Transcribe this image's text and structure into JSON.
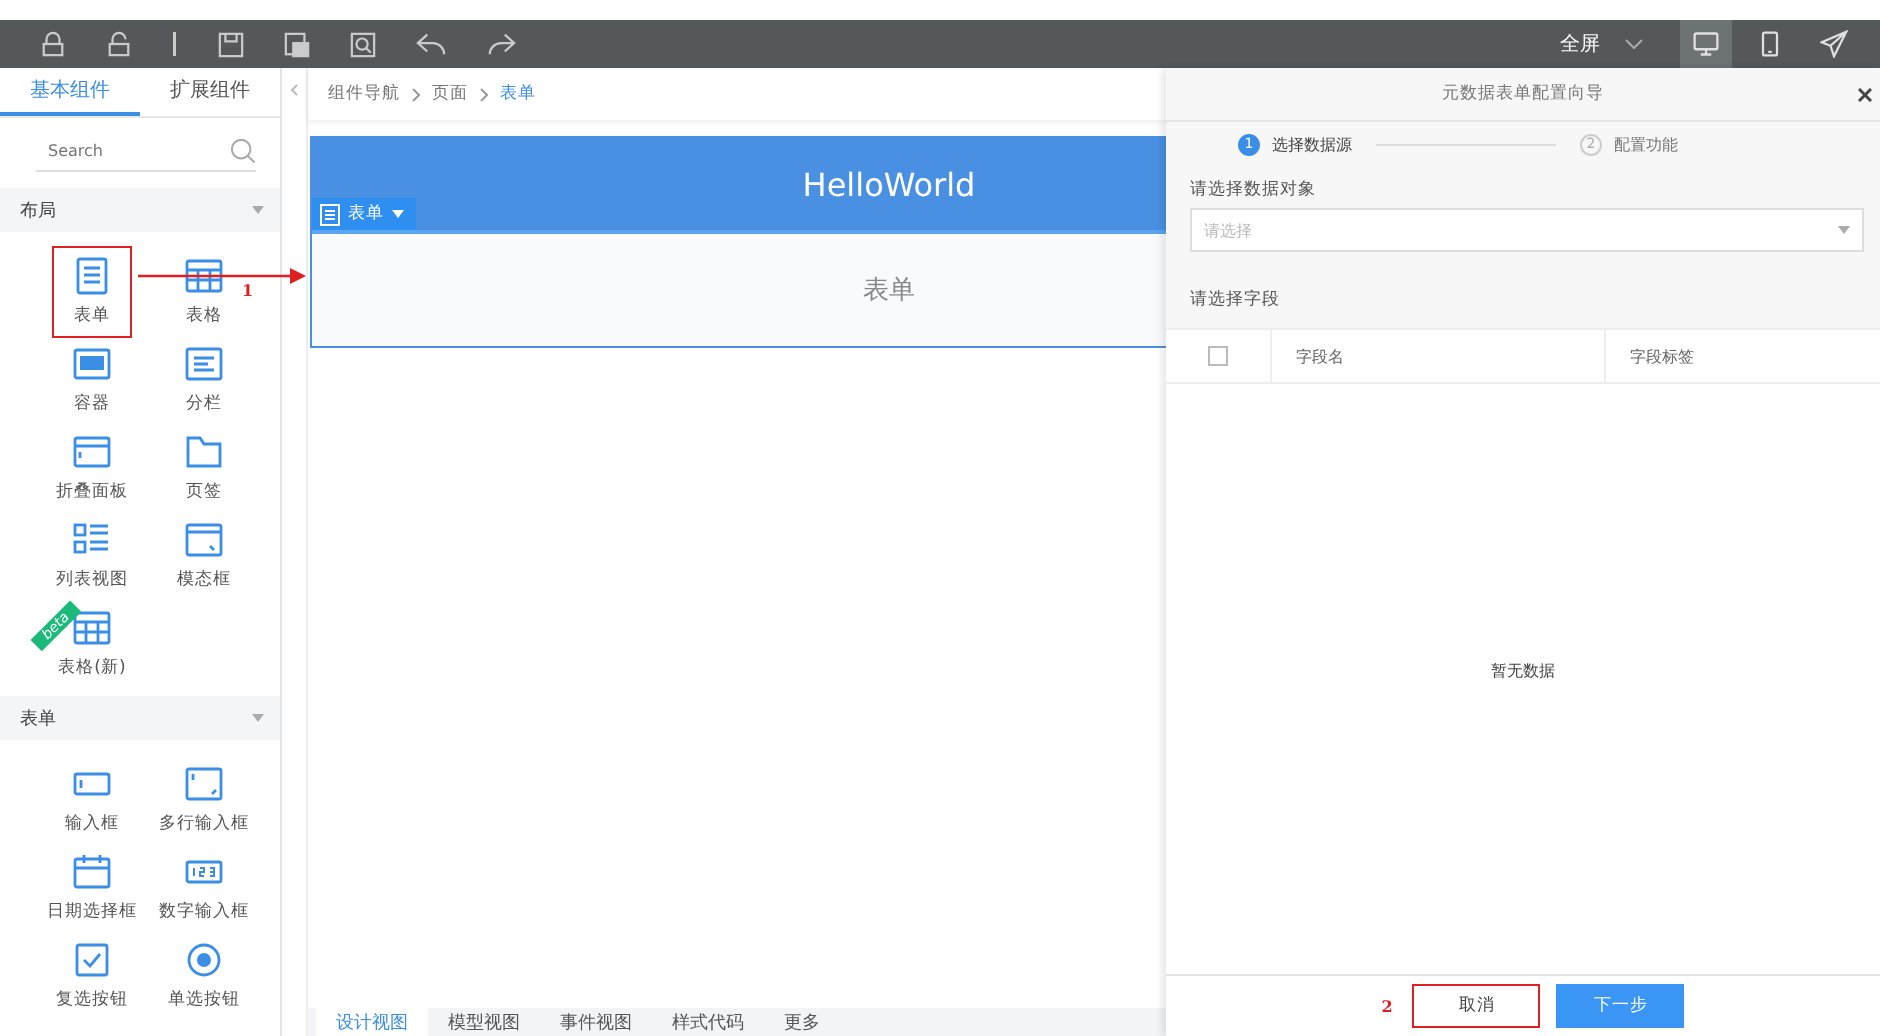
{
  "toolbar": {
    "fullscreen_label": "全屏",
    "views": [
      {
        "kind": "desktop",
        "selected": true
      },
      {
        "kind": "mobile",
        "selected": false
      },
      {
        "kind": "publish",
        "selected": false
      }
    ]
  },
  "sidebar": {
    "tabs": [
      {
        "label": "基本组件",
        "selected": true
      },
      {
        "label": "扩展组件",
        "selected": false
      }
    ],
    "search": {
      "placeholder": "Search"
    },
    "sections": [
      {
        "title": "布局",
        "expanded": true,
        "items": [
          {
            "label": "表单",
            "kind": "form",
            "annotation": "1"
          },
          {
            "label": "表格",
            "kind": "table"
          },
          {
            "label": "容器",
            "kind": "container"
          },
          {
            "label": "分栏",
            "kind": "columns"
          },
          {
            "label": "折叠面板",
            "kind": "collapse"
          },
          {
            "label": "页签",
            "kind": "tabs"
          },
          {
            "label": "列表视图",
            "kind": "list"
          },
          {
            "label": "模态框",
            "kind": "modal"
          },
          {
            "label": "表格(新)",
            "kind": "table",
            "badge": "beta"
          }
        ]
      },
      {
        "title": "表单",
        "expanded": true,
        "items": [
          {
            "label": "输入框",
            "kind": "input"
          },
          {
            "label": "多行输入框",
            "kind": "textarea"
          },
          {
            "label": "日期选择框",
            "kind": "date"
          },
          {
            "label": "数字输入框",
            "kind": "number"
          },
          {
            "label": "复选按钮",
            "kind": "checkbox"
          },
          {
            "label": "单选按钮",
            "kind": "radio"
          }
        ]
      }
    ]
  },
  "breadcrumb": [
    {
      "label": "组件导航",
      "selected": false
    },
    {
      "label": "页面",
      "selected": false
    },
    {
      "label": "表单",
      "selected": true
    }
  ],
  "canvas": {
    "page_title": "HelloWorld",
    "component_tag": "表单",
    "component_body": "表单"
  },
  "bottom_tabs": [
    {
      "label": "设计视图",
      "selected": true
    },
    {
      "label": "模型视图",
      "selected": false
    },
    {
      "label": "事件视图",
      "selected": false
    },
    {
      "label": "样式代码",
      "selected": false
    },
    {
      "label": "更多",
      "selected": false
    }
  ],
  "wizard": {
    "title": "元数据表单配置向导",
    "steps": [
      {
        "number": "1",
        "label": "选择数据源",
        "selected": true
      },
      {
        "number": "2",
        "label": "配置功能",
        "selected": false
      }
    ],
    "object_label": "请选择数据对象",
    "object_select": {
      "placeholder": "请选择"
    },
    "fields_label": "请选择字段",
    "table": {
      "select_all_checked": false,
      "columns": [
        "字段名",
        "字段标签"
      ],
      "empty_text": "暂无数据"
    },
    "buttons": [
      {
        "label": "取消",
        "kind": "secondary",
        "annotation": "2"
      },
      {
        "label": "下一步",
        "kind": "primary"
      }
    ]
  }
}
